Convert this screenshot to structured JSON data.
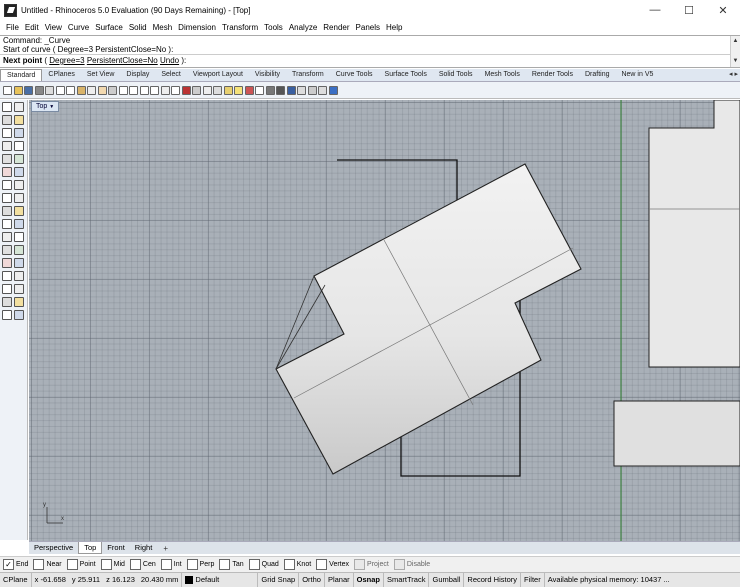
{
  "window": {
    "title": "Untitled - Rhinoceros 5.0 Evaluation (90 Days Remaining) - [Top]",
    "controls": {
      "minimize": "—",
      "maximize": "☐",
      "close": "✕"
    }
  },
  "menu": [
    "File",
    "Edit",
    "View",
    "Curve",
    "Surface",
    "Solid",
    "Mesh",
    "Dimension",
    "Transform",
    "Tools",
    "Analyze",
    "Render",
    "Panels",
    "Help"
  ],
  "command": {
    "line1": "Command: _Curve",
    "line2": "Start of curve ( Degree=3  PersistentClose=No ):",
    "prompt_bold": "Next point",
    "prompt_rest1": " ( ",
    "opt_degree": "Degree=3",
    "prompt_rest2": "  ",
    "opt_persist": "PersistentClose=No",
    "prompt_rest3": "  ",
    "opt_undo": "Undo",
    "prompt_rest4": " ):",
    "scroll_up": "▲",
    "scroll_down": "▼"
  },
  "toolbar_tabs": [
    "Standard",
    "CPlanes",
    "Set View",
    "Display",
    "Select",
    "Viewport Layout",
    "Visibility",
    "Transform",
    "Curve Tools",
    "Surface Tools",
    "Solid Tools",
    "Mesh Tools",
    "Render Tools",
    "Drafting",
    "New in V5"
  ],
  "toolbar_tab_arrows": "◂ ▸",
  "viewport": {
    "name": "Top",
    "caret": "▼",
    "axis_x": "x",
    "axis_y": "y"
  },
  "view_tabs": [
    "Perspective",
    "Top",
    "Front",
    "Right"
  ],
  "view_tab_add": "+",
  "osnaps": [
    {
      "label": "End",
      "checked": true
    },
    {
      "label": "Near",
      "checked": false
    },
    {
      "label": "Point",
      "checked": false
    },
    {
      "label": "Mid",
      "checked": false
    },
    {
      "label": "Cen",
      "checked": false
    },
    {
      "label": "Int",
      "checked": false
    },
    {
      "label": "Perp",
      "checked": false
    },
    {
      "label": "Tan",
      "checked": false
    },
    {
      "label": "Quad",
      "checked": false
    },
    {
      "label": "Knot",
      "checked": false
    },
    {
      "label": "Vertex",
      "checked": false
    },
    {
      "label": "Project",
      "checked": false,
      "muted": true
    },
    {
      "label": "Disable",
      "checked": false,
      "muted": true
    }
  ],
  "osnap_check": "✓",
  "status": {
    "cplane": "CPlane",
    "x": "x -61.658",
    "y": "y 25.911",
    "z": "z 16.123",
    "distance": "20.430 mm",
    "layer": "Default",
    "grid_snap": "Grid Snap",
    "ortho": "Ortho",
    "planar": "Planar",
    "osnap": "Osnap",
    "smarttrack": "SmartTrack",
    "gumball": "Gumball",
    "record_history": "Record History",
    "filter": "Filter",
    "memory": "Available physical memory: 10437 ..."
  },
  "colors": {
    "viewport_bg": "#a9b0b8",
    "surface": "#e6e6e6",
    "curve": "#111111",
    "y_axis": "#3c8a3c"
  }
}
